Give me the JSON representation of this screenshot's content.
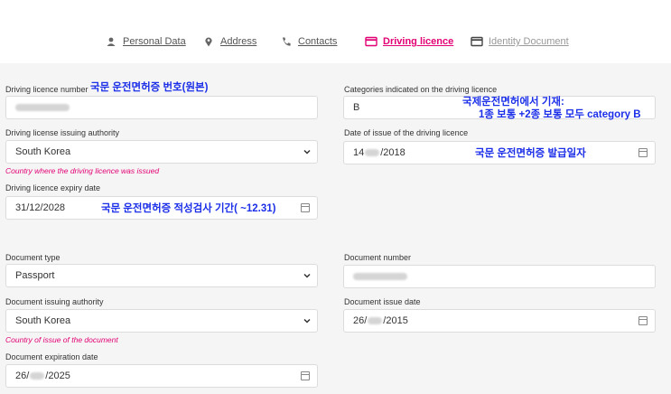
{
  "tabs": [
    {
      "label": "Personal Data",
      "icon": "person-icon"
    },
    {
      "label": "Address",
      "icon": "location-pin-icon"
    },
    {
      "label": "Contacts",
      "icon": "phone-icon"
    },
    {
      "label": "Driving licence",
      "icon": "card-icon"
    },
    {
      "label": "Identity Document",
      "icon": "card-icon"
    }
  ],
  "colors": {
    "accent": "#e20074",
    "annotation": "#1b2ee8"
  },
  "driving": {
    "number_label": "Driving licence number",
    "number_note": "국문 운전면허증 번호(원본)",
    "categories_label": "Categories indicated on the driving licence",
    "categories_value": "B",
    "categories_note_line1": "국제운전면허에서 기재:",
    "categories_note_line2": "1종 보통 +2종 보통 모두 category B",
    "authority_label": "Driving license issuing authority",
    "authority_value": "South Korea",
    "authority_hint": "Country where the driving licence was issued",
    "issue_label": "Date of issue of the driving licence",
    "issue_day": "14",
    "issue_year": "/2018",
    "issue_note": "국문 운전면허증 발급일자",
    "expiry_label": "Driving licence expiry date",
    "expiry_value": "31/12/2028",
    "expiry_note": "국문 운전면허증 적성검사 기간( ~12.31)"
  },
  "document": {
    "type_label": "Document type",
    "type_value": "Passport",
    "number_label": "Document number",
    "authority_label": "Document issuing authority",
    "authority_value": "South Korea",
    "authority_hint": "Country of issue of the document",
    "issue_label": "Document issue date",
    "issue_day": "26/",
    "issue_year": "/2015",
    "expiry_label": "Document expiration date",
    "expiry_day": "26/",
    "expiry_year": "/2025"
  }
}
